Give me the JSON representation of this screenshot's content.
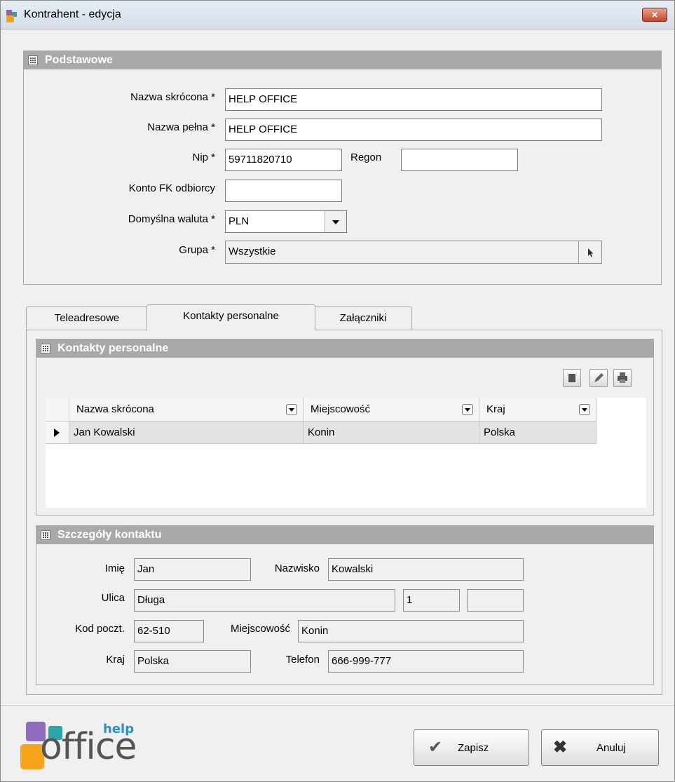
{
  "window": {
    "title": "Kontrahent - edycja",
    "close_label": "×"
  },
  "basic": {
    "header": "Podstawowe",
    "short_name_label": "Nazwa skrócona *",
    "short_name_value": "HELP OFFICE",
    "full_name_label": "Nazwa pełna *",
    "full_name_value": "HELP OFFICE",
    "nip_label": "Nip *",
    "nip_value": "59711820710",
    "regon_label": "Regon",
    "regon_value": "",
    "fk_label": "Konto FK odbiorcy",
    "fk_value": "",
    "currency_label": "Domyślna waluta *",
    "currency_value": "PLN",
    "group_label": "Grupa *",
    "group_value": "Wszystkie"
  },
  "tabs": [
    {
      "label": "Teleadresowe",
      "active": false
    },
    {
      "label": "Kontakty personalne",
      "active": true
    },
    {
      "label": "Załączniki",
      "active": false
    }
  ],
  "contacts": {
    "header": "Kontakty personalne",
    "columns": [
      "Nazwa skrócona",
      "Miejscowość",
      "Kraj"
    ],
    "rows": [
      {
        "name": "Jan Kowalski",
        "city": "Konin",
        "country": "Polska"
      }
    ]
  },
  "details": {
    "header": "Szczegóły kontaktu",
    "first_name_label": "Imię",
    "first_name_value": "Jan",
    "last_name_label": "Nazwisko",
    "last_name_value": "Kowalski",
    "street_label": "Ulica",
    "street_value": "Długa",
    "house_no_value": "1",
    "apt_no_value": "",
    "postal_label": "Kod poczt.",
    "postal_value": "62-510",
    "city_label": "Miejscowość",
    "city_value": "Konin",
    "country_label": "Kraj",
    "country_value": "Polska",
    "phone_label": "Telefon",
    "phone_value": "666-999-777"
  },
  "footer": {
    "logo_text": "office",
    "logo_small": "help",
    "save_label": "Zapisz",
    "cancel_label": "Anuluj"
  }
}
